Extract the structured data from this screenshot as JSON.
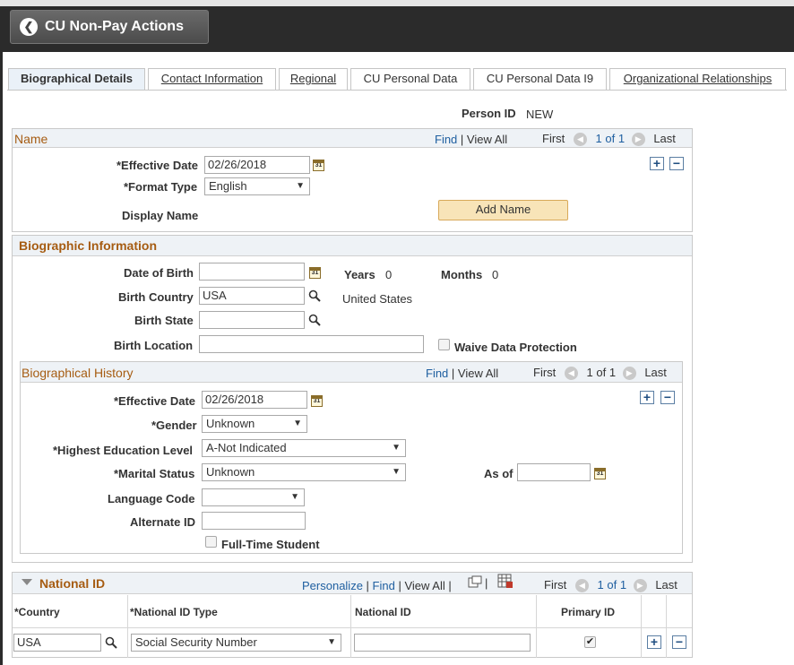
{
  "header": {
    "back_label": "CU Non-Pay Actions"
  },
  "tabs": [
    {
      "label": "Biographical Details"
    },
    {
      "label": "Contact Information"
    },
    {
      "label": "Regional"
    },
    {
      "label": "CU Personal Data"
    },
    {
      "label": "CU Personal Data I9"
    },
    {
      "label": "Organizational Relationships"
    }
  ],
  "person": {
    "label": "Person ID",
    "value": "NEW"
  },
  "nav": {
    "find": "Find",
    "view_all": "View All",
    "first": "First",
    "count": "1 of 1",
    "last": "Last",
    "personalize": "Personalize"
  },
  "name_section": {
    "title": "Name",
    "effective_date_label": "*Effective Date",
    "effective_date": "02/26/2018",
    "format_type_label": "*Format Type",
    "format_type": "English",
    "display_name_label": "Display Name",
    "add_name_button": "Add Name"
  },
  "bio_info": {
    "title": "Biographic Information",
    "dob_label": "Date of Birth",
    "dob": "",
    "years_label": "Years",
    "years": "0",
    "months_label": "Months",
    "months": "0",
    "birth_country_label": "Birth Country",
    "birth_country": "USA",
    "birth_country_desc": "United States",
    "birth_state_label": "Birth State",
    "birth_state": "",
    "birth_location_label": "Birth Location",
    "birth_location": "",
    "waive_label": "Waive Data Protection"
  },
  "bio_history": {
    "title": "Biographical History",
    "effective_date_label": "*Effective Date",
    "effective_date": "02/26/2018",
    "gender_label": "*Gender",
    "gender": "Unknown",
    "education_label": "*Highest Education Level",
    "education": "A-Not Indicated",
    "marital_label": "*Marital Status",
    "marital": "Unknown",
    "as_of_label": "As of",
    "as_of": "",
    "language_label": "Language Code",
    "language": "",
    "alternate_id_label": "Alternate ID",
    "alternate_id": "",
    "fulltime_label": "Full-Time Student"
  },
  "national_id": {
    "title": "National ID",
    "columns": [
      "*Country",
      "*National ID Type",
      "National ID",
      "Primary ID"
    ],
    "row": {
      "country": "USA",
      "type": "Social Security Number",
      "id": "",
      "primary": true
    }
  },
  "colors": {
    "accent": "#a65c12",
    "link": "#1f5fa0",
    "topbar": "#2b2b2b"
  }
}
